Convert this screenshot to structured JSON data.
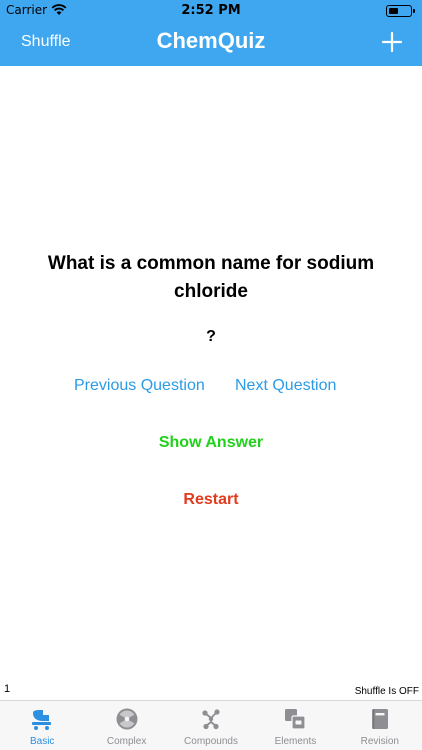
{
  "status_bar": {
    "carrier": "Carrier",
    "time": "2:52 PM"
  },
  "nav": {
    "left_label": "Shuffle",
    "title": "ChemQuiz",
    "add_icon": "plus-icon"
  },
  "quiz": {
    "question": "What is a common name for sodium chloride",
    "answer": "?",
    "previous_label": "Previous Question",
    "next_label": "Next Question",
    "show_answer_label": "Show Answer",
    "restart_label": "Restart"
  },
  "footer": {
    "question_number": "1",
    "shuffle_status": "Shuffle Is OFF"
  },
  "tabs": [
    {
      "label": "Basic",
      "icon": "stroller-icon",
      "active": true
    },
    {
      "label": "Complex",
      "icon": "radiation-icon",
      "active": false
    },
    {
      "label": "Compounds",
      "icon": "molecule-icon",
      "active": false
    },
    {
      "label": "Elements",
      "icon": "element-tiles-icon",
      "active": false
    },
    {
      "label": "Revision",
      "icon": "book-icon",
      "active": false
    }
  ],
  "colors": {
    "header": "#3fa7ef",
    "link": "#2b9be6",
    "show_answer": "#22d11c",
    "restart": "#e23b1e",
    "tab_active": "#2b8fe2",
    "tab_inactive": "#8e8e93"
  }
}
